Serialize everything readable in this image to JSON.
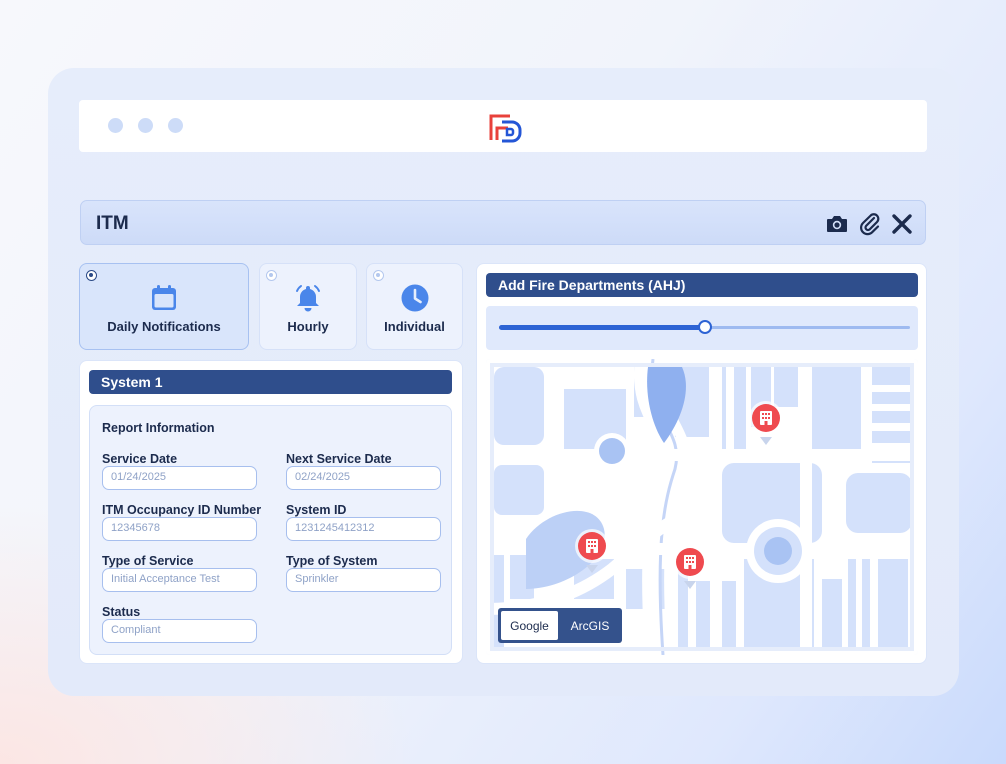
{
  "window": {
    "title": "ITM",
    "logo": "fp-logo"
  },
  "toolbar": {
    "icons": [
      "camera-icon",
      "paperclip-icon",
      "close-icon"
    ]
  },
  "notifications": {
    "options": [
      {
        "label": "Daily Notifications",
        "icon": "calendar-icon",
        "selected": true
      },
      {
        "label": "Hourly",
        "icon": "bell-icon",
        "selected": false
      },
      {
        "label": "Individual",
        "icon": "clock-icon",
        "selected": false
      }
    ]
  },
  "system": {
    "header": "System 1",
    "report_title": "Report Information",
    "fields": {
      "service_date": {
        "label": "Service Date",
        "value": "01/24/2025"
      },
      "next_service_date": {
        "label": "Next Service Date",
        "value": "02/24/2025"
      },
      "occupancy_id": {
        "label": "ITM Occupancy ID Number",
        "value": "12345678"
      },
      "system_id": {
        "label": "System ID",
        "value": "1231245412312"
      },
      "type_of_service": {
        "label": "Type of Service",
        "value": "Initial Acceptance Test"
      },
      "type_of_system": {
        "label": "Type of System",
        "value": "Sprinkler"
      },
      "status": {
        "label": "Status",
        "value": "Compliant"
      }
    }
  },
  "fire_departments": {
    "header": "Add Fire Departments (AHJ)",
    "radius_fraction": 0.5,
    "map_providers": {
      "google": "Google",
      "arcgis": "ArcGIS",
      "selected": "Google"
    },
    "markers": [
      "building-marker-icon",
      "building-marker-icon",
      "building-marker-icon"
    ]
  },
  "colors": {
    "accent": "#2f4e8c",
    "slider": "#2d63d4",
    "marker": "#ef4a4f",
    "logo_red": "#e8413b",
    "logo_blue": "#2456d6"
  }
}
